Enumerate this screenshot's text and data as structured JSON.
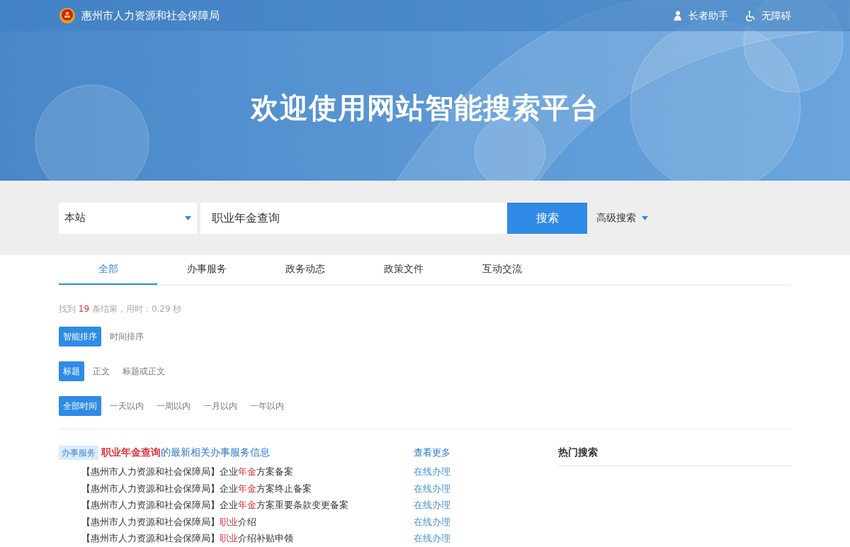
{
  "header": {
    "site_name": "惠州市人力资源和社会保障局",
    "links": [
      {
        "kind": "elder",
        "label": "长者助手"
      },
      {
        "kind": "accessible",
        "label": "无障碍"
      }
    ]
  },
  "banner": {
    "title": "欢迎使用网站智能搜索平台"
  },
  "search": {
    "scope": "本站",
    "value": "职业年金查询",
    "button": "搜索",
    "advanced": "高级搜索"
  },
  "tabs": [
    {
      "label": "全部",
      "selected": true
    },
    {
      "label": "办事服务",
      "selected": false
    },
    {
      "label": "政务动态",
      "selected": false
    },
    {
      "label": "政策文件",
      "selected": false
    },
    {
      "label": "互动交流",
      "selected": false
    }
  ],
  "result_summary": {
    "prefix": "找到",
    "count": "19",
    "suffix": "条结果，用时：0.29 秒"
  },
  "filters": [
    {
      "options": [
        {
          "label": "智能排序",
          "selected": true
        },
        {
          "label": "时间排序",
          "selected": false
        }
      ]
    },
    {
      "options": [
        {
          "label": "标题",
          "selected": true
        },
        {
          "label": "正文",
          "selected": false
        },
        {
          "label": "标题或正文",
          "selected": false
        }
      ]
    },
    {
      "options": [
        {
          "label": "全部时间",
          "selected": true
        },
        {
          "label": "一天以内",
          "selected": false
        },
        {
          "label": "一周以内",
          "selected": false
        },
        {
          "label": "一月以内",
          "selected": false
        },
        {
          "label": "一年以内",
          "selected": false
        }
      ]
    }
  ],
  "service_block": {
    "tag": "办事服务",
    "heading": [
      {
        "text": "职业年金查询",
        "highlight": true
      },
      {
        "text": "的最新相关办事服务信息",
        "highlight": false
      }
    ],
    "more": "查看更多",
    "items": [
      {
        "parts": [
          {
            "text": "【惠州市人力资源和社会保障局】企业",
            "highlight": false
          },
          {
            "text": "年金",
            "highlight": true
          },
          {
            "text": "方案备案",
            "highlight": false
          }
        ],
        "action": "在线办理"
      },
      {
        "parts": [
          {
            "text": "【惠州市人力资源和社会保障局】企业",
            "highlight": false
          },
          {
            "text": "年金",
            "highlight": true
          },
          {
            "text": "方案终止备案",
            "highlight": false
          }
        ],
        "action": "在线办理"
      },
      {
        "parts": [
          {
            "text": "【惠州市人力资源和社会保障局】企业",
            "highlight": false
          },
          {
            "text": "年金",
            "highlight": true
          },
          {
            "text": "方案重要条款变更备案",
            "highlight": false
          }
        ],
        "action": "在线办理"
      },
      {
        "parts": [
          {
            "text": "【惠州市人力资源和社会保障局】",
            "highlight": false
          },
          {
            "text": "职业",
            "highlight": true
          },
          {
            "text": "介绍",
            "highlight": false
          }
        ],
        "action": "在线办理"
      },
      {
        "parts": [
          {
            "text": "【惠州市人力资源和社会保障局】",
            "highlight": false
          },
          {
            "text": "职业",
            "highlight": true
          },
          {
            "text": "介绍补贴申领",
            "highlight": false
          }
        ],
        "action": "在线办理"
      }
    ]
  },
  "hot_search": {
    "title": "热门搜索"
  }
}
